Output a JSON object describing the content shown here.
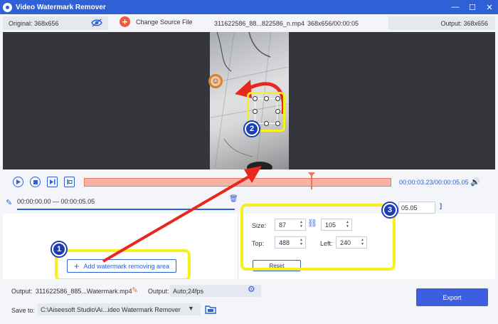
{
  "app": {
    "title": "Video Watermark Remover",
    "window_controls": [
      "—",
      "☐",
      "✕"
    ]
  },
  "infobar": {
    "original": "Original: 368x656",
    "change_source_label": "Change Source File",
    "filename": "311622586_88...822586_n.mp4",
    "fileinfo": "368x656/00:00:05",
    "output": "Output: 368x656"
  },
  "playback": {
    "time": "00:00:03.23/00:00:05.05",
    "playhead_fraction": 0.74,
    "range": "00:00:00.00 — 00:00:05.05",
    "end_time": "05.05",
    "bracket": "]"
  },
  "area": {
    "add_label": "Add watermark removing area",
    "size_label": "Size:",
    "width": "87",
    "height": "105",
    "top_label": "Top:",
    "top": "488",
    "left_label": "Left:",
    "left": "240",
    "reset_label": "Reset"
  },
  "badges": [
    "1",
    "2",
    "3"
  ],
  "bottom": {
    "output_label": "Output:",
    "output_file": "311622586_885...Watermark.mp4",
    "output_format_label": "Output:",
    "output_format": "Auto;24fps",
    "save_to_label": "Save to:",
    "save_path": "C:\\Aiseesoft Studio\\Ai...ideo Watermark Remover",
    "export_label": "Export"
  },
  "colors": {
    "accent": "#2f60d6",
    "highlight": "#f7f01d",
    "arrow": "#e8281e",
    "timeline": "#f6b4a8",
    "export": "#3e5ee0"
  }
}
